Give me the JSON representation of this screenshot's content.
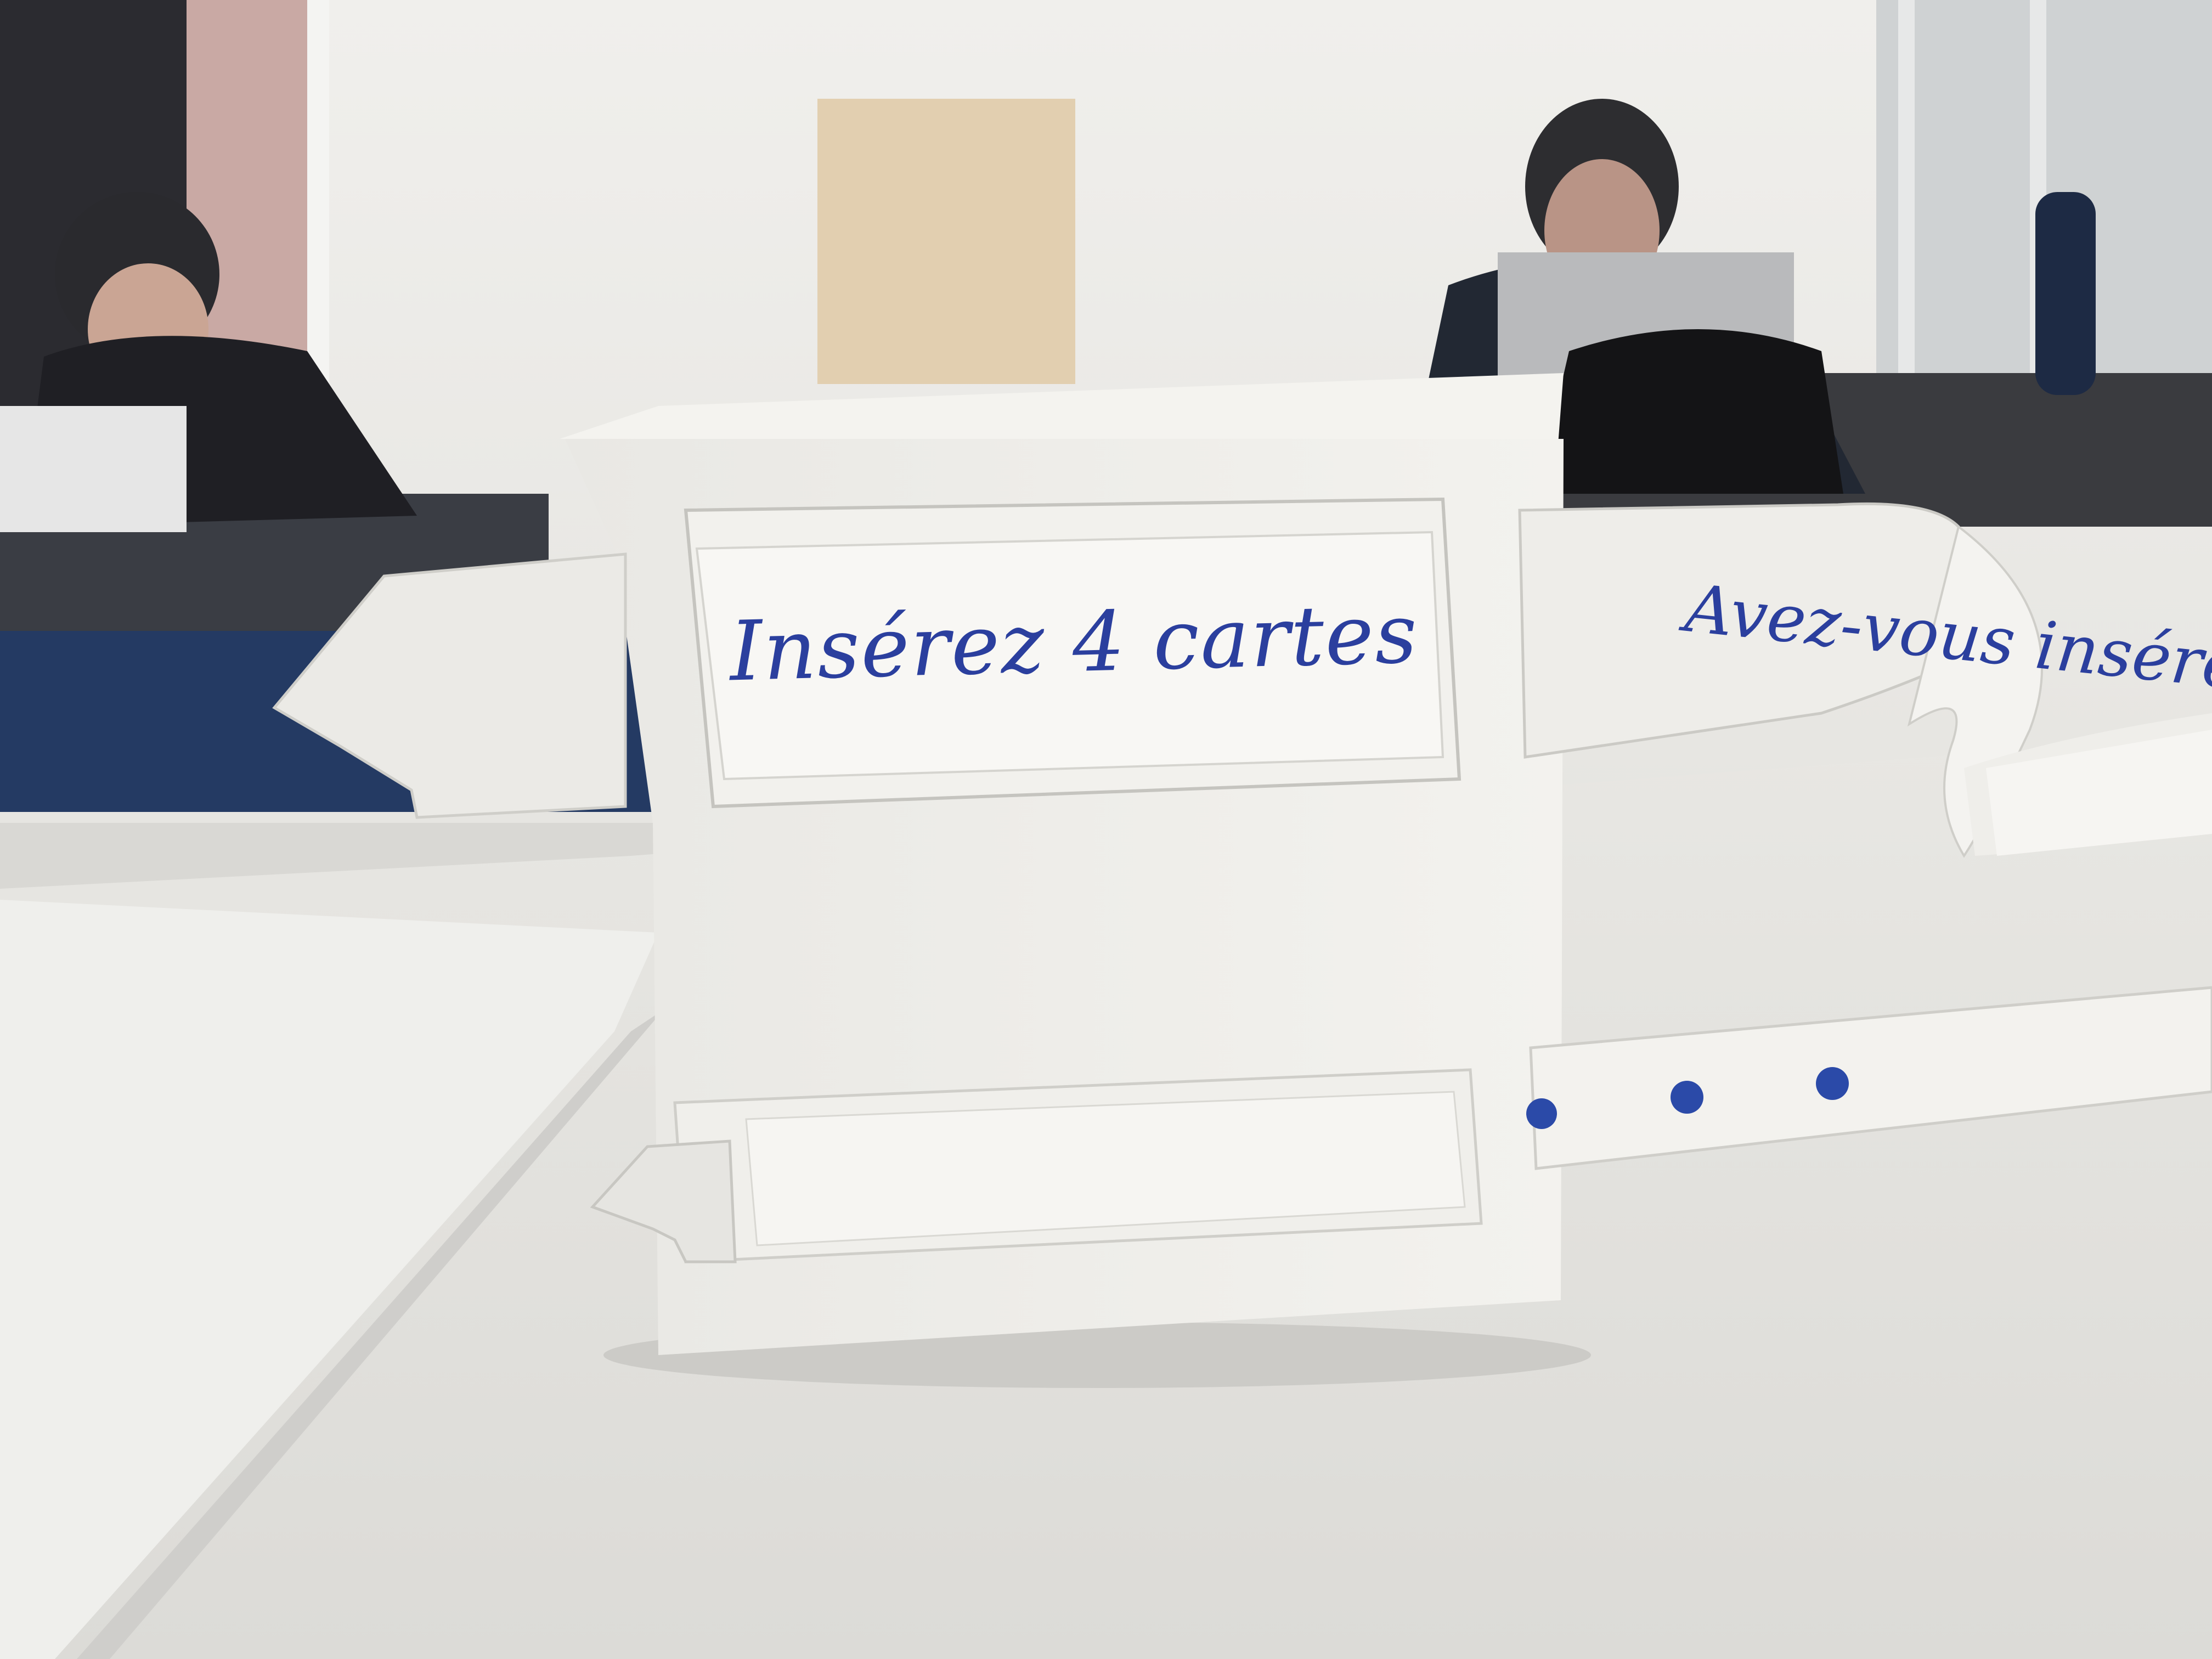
{
  "prototype": {
    "screen_text": "Insérez 4 cartes",
    "strip_text": "Avez-vous inséré",
    "progress_dots": 3,
    "ink_color": "#2b4aa8"
  }
}
